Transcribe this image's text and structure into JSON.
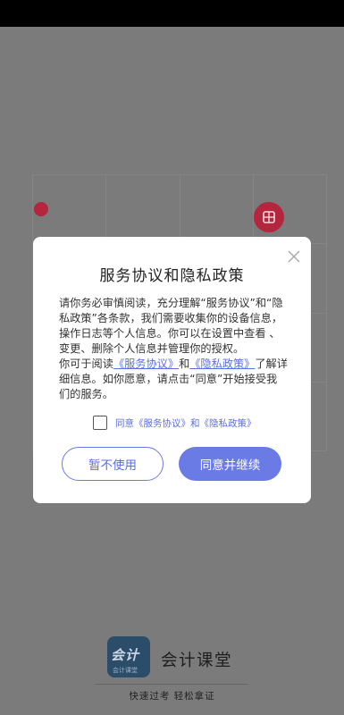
{
  "modal": {
    "title": "服务协议和隐私政策",
    "body": {
      "p1": "请你务必审慎阅读，充分理解“服务协议”和“隐私政策”各条款，我们需要收集你的设备信息，操作日志等个人信息。你可以在设置中查看 、变更、删除个人信息并管理你的授权。",
      "p2_pre": "你可于阅读",
      "p2_link1": "《服务协议》",
      "p2_mid": "和",
      "p2_link2": "《隐私政策》",
      "p2_post": "了解详细信息。如你愿意，请点击“同意”开始接受我们的服务。"
    },
    "agree_label": "同意《服务协议》和《隐私政策》",
    "decline_label": "暂不使用",
    "accept_label": "同意并继续"
  },
  "splash": {
    "logo_text": "会计",
    "logo_subtext": "会计课堂",
    "app_name": "会计课堂",
    "slogan": "快速过考 轻松拿证"
  },
  "colors": {
    "accent": "#6b7be6",
    "link": "#5b6ee0",
    "fab": "#b3263d",
    "overlay": "#7b7b7b"
  },
  "icons": {
    "close": "close-icon",
    "fab": "grid-icon"
  }
}
